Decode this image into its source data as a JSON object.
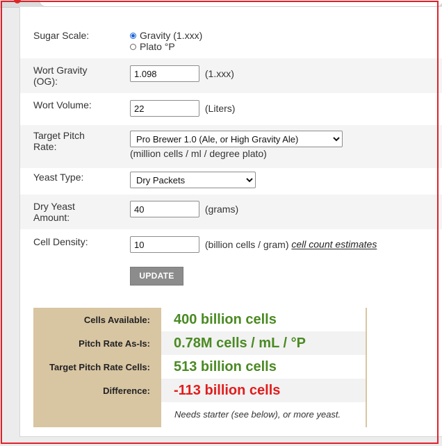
{
  "browser": {
    "url_partial": "brewersfriend.com/yeast-pitch-rate-and-starter-calculator/#...?#/reviews-..."
  },
  "form": {
    "sugar_scale": {
      "label": "Sugar Scale:",
      "options": [
        "Gravity (1.xxx)",
        "Plato °P"
      ],
      "selected": "Gravity (1.xxx)"
    },
    "wort_gravity": {
      "label_line1": "Wort Gravity",
      "label_line2": "(OG):",
      "value": "1.098",
      "unit": "(1.xxx)"
    },
    "wort_volume": {
      "label": "Wort Volume:",
      "value": "22",
      "unit": "(Liters)"
    },
    "target_pitch_rate": {
      "label_line1": "Target Pitch",
      "label_line2": "Rate:",
      "selected": "Pro Brewer 1.0 (Ale, or High Gravity Ale)",
      "unit": "(million cells / ml / degree plato)"
    },
    "yeast_type": {
      "label": "Yeast Type:",
      "selected": "Dry Packets"
    },
    "dry_yeast_amount": {
      "label_line1": "Dry Yeast",
      "label_line2": "Amount:",
      "value": "40",
      "unit": "(grams)"
    },
    "cell_density": {
      "label": "Cell Density:",
      "value": "10",
      "unit": "(billion cells / gram)",
      "link": "cell count estimates"
    },
    "update_button": "UPDATE"
  },
  "results": {
    "cells_available": {
      "label": "Cells Available:",
      "value": "400 billion cells"
    },
    "pitch_rate": {
      "label": "Pitch Rate As-Is:",
      "value": "0.78M cells / mL / °P"
    },
    "target_cells": {
      "label": "Target Pitch Rate Cells:",
      "value": "513 billion cells"
    },
    "difference": {
      "label": "Difference:",
      "value": "-113 billion cells"
    },
    "note": "Needs starter (see below), or more yeast."
  },
  "colors": {
    "accent_green": "#4a8a22",
    "alert_red": "#e21c1c",
    "results_tan": "#d8c5a2",
    "button_gray": "#8c8c8c",
    "selection_border": "#e0202a"
  }
}
